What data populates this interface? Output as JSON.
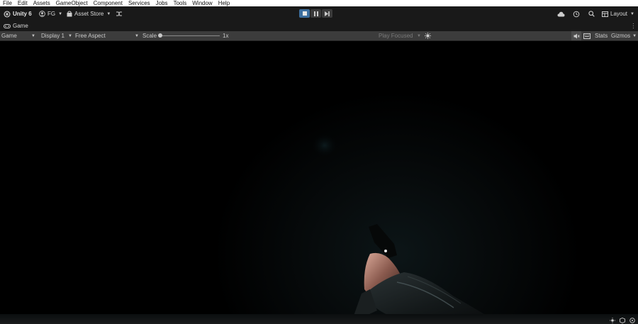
{
  "menu": [
    "File",
    "Edit",
    "Assets",
    "GameObject",
    "Component",
    "Services",
    "Jobs",
    "Tools",
    "Window",
    "Help"
  ],
  "toolbar": {
    "unity_label": "Unity 6",
    "account_label": "FG",
    "asset_store_label": "Asset Store",
    "layout_label": "Layout"
  },
  "tab": {
    "game_label": "Game"
  },
  "gamebar": {
    "view_label": "Game",
    "display_label": "Display 1",
    "aspect_label": "Free Aspect",
    "scale_label": "Scale",
    "scale_value": "1x",
    "scale_fraction": 0.0,
    "play_focused_label": "Play Focused",
    "stats_label": "Stats",
    "gizmos_label": "Gizmos"
  },
  "colors": {
    "menubar_bg": "#ffffff",
    "toolbar_bg": "#191919",
    "gamebar_bg": "#3c3c3c",
    "play_active": "#3c6e9e"
  },
  "play_state": {
    "playing": true,
    "paused": false
  }
}
